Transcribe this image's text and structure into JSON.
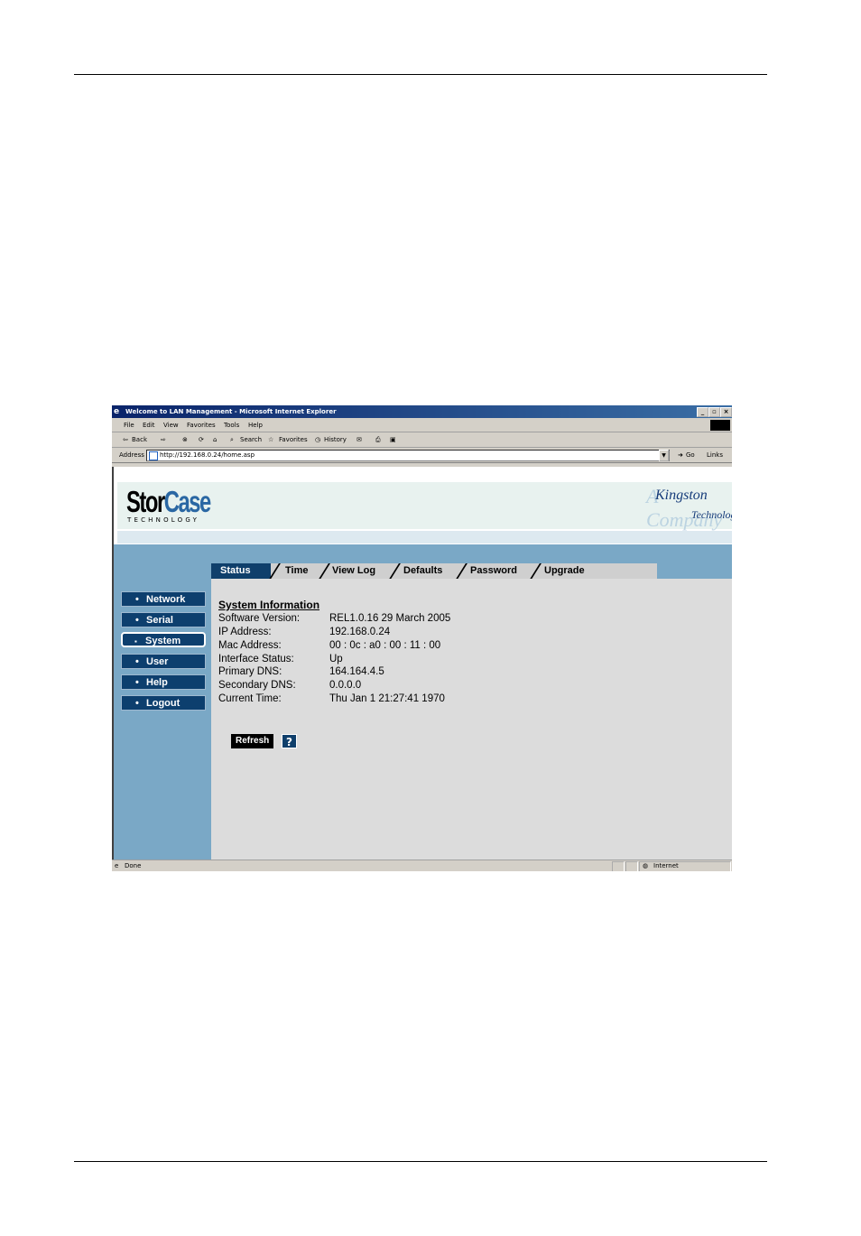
{
  "window": {
    "title": "Welcome to LAN Management - Microsoft Internet Explorer",
    "controls": {
      "minimize": "_",
      "restore": "▫",
      "close": "×"
    }
  },
  "menubar": [
    "File",
    "Edit",
    "View",
    "Favorites",
    "Tools",
    "Help"
  ],
  "toolbar": {
    "back": "Back",
    "search": "Search",
    "favorites": "Favorites",
    "history": "History"
  },
  "addressbar": {
    "label": "Address",
    "url": "http://192.168.0.24/home.asp",
    "go": "Go",
    "links": "Links"
  },
  "banner": {
    "logo_main_a": "Stor",
    "logo_main_b": "Case",
    "logo_sub": "TECHNOLOGY",
    "partner_line1": "Kingston",
    "partner_line2": "Technology",
    "partner_watermark": "A Company"
  },
  "tabs": [
    {
      "label": "Status",
      "active": true
    },
    {
      "label": "Time"
    },
    {
      "label": "View Log"
    },
    {
      "label": "Defaults"
    },
    {
      "label": "Password"
    },
    {
      "label": "Upgrade"
    }
  ],
  "sidebar": [
    {
      "label": "Network"
    },
    {
      "label": "Serial"
    },
    {
      "label": "System",
      "selected": true
    },
    {
      "label": "User"
    },
    {
      "label": "Help"
    },
    {
      "label": "Logout"
    }
  ],
  "system_info": {
    "title": "System Information",
    "rows": [
      {
        "key": "Software Version:",
        "value": "REL1.0.16 29 March 2005"
      },
      {
        "key": "IP Address:",
        "value": "192.168.0.24"
      },
      {
        "key": "Mac Address:",
        "value": "00 : 0c : a0 : 00 : 11 : 00"
      },
      {
        "key": "Interface Status:",
        "value": "Up"
      },
      {
        "key": "Primary DNS:",
        "value": "164.164.4.5"
      },
      {
        "key": "Secondary DNS:",
        "value": "0.0.0.0"
      },
      {
        "key": "Current Time:",
        "value": "Thu Jan 1 21:27:41 1970"
      }
    ],
    "refresh_label": "Refresh",
    "help_label": "?"
  },
  "statusbar": {
    "left": "Done",
    "zone": "Internet"
  }
}
